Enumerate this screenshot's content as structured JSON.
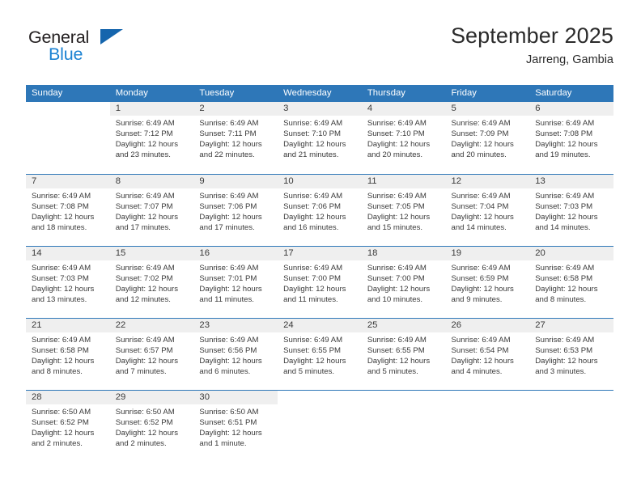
{
  "logo": {
    "word1": "General",
    "word2": "Blue",
    "triangle_color": "#1565ad",
    "word2_color": "#1b82d2"
  },
  "header": {
    "title": "September 2025",
    "subtitle": "Jarreng, Gambia"
  },
  "theme": {
    "header_blue": "#2e77b8",
    "daynum_gray": "#efefef",
    "text": "#3a3a3a"
  },
  "weekdays": [
    "Sunday",
    "Monday",
    "Tuesday",
    "Wednesday",
    "Thursday",
    "Friday",
    "Saturday"
  ],
  "labels": {
    "sunrise": "Sunrise:",
    "sunset": "Sunset:",
    "daylight": "Daylight:"
  },
  "weeks": [
    [
      {
        "day": "",
        "line1": "",
        "line2": "",
        "line3": "",
        "line4": "",
        "empty": true
      },
      {
        "day": "1",
        "line1": "Sunrise: 6:49 AM",
        "line2": "Sunset: 7:12 PM",
        "line3": "Daylight: 12 hours",
        "line4": "and 23 minutes."
      },
      {
        "day": "2",
        "line1": "Sunrise: 6:49 AM",
        "line2": "Sunset: 7:11 PM",
        "line3": "Daylight: 12 hours",
        "line4": "and 22 minutes."
      },
      {
        "day": "3",
        "line1": "Sunrise: 6:49 AM",
        "line2": "Sunset: 7:10 PM",
        "line3": "Daylight: 12 hours",
        "line4": "and 21 minutes."
      },
      {
        "day": "4",
        "line1": "Sunrise: 6:49 AM",
        "line2": "Sunset: 7:10 PM",
        "line3": "Daylight: 12 hours",
        "line4": "and 20 minutes."
      },
      {
        "day": "5",
        "line1": "Sunrise: 6:49 AM",
        "line2": "Sunset: 7:09 PM",
        "line3": "Daylight: 12 hours",
        "line4": "and 20 minutes."
      },
      {
        "day": "6",
        "line1": "Sunrise: 6:49 AM",
        "line2": "Sunset: 7:08 PM",
        "line3": "Daylight: 12 hours",
        "line4": "and 19 minutes."
      }
    ],
    [
      {
        "day": "7",
        "line1": "Sunrise: 6:49 AM",
        "line2": "Sunset: 7:08 PM",
        "line3": "Daylight: 12 hours",
        "line4": "and 18 minutes."
      },
      {
        "day": "8",
        "line1": "Sunrise: 6:49 AM",
        "line2": "Sunset: 7:07 PM",
        "line3": "Daylight: 12 hours",
        "line4": "and 17 minutes."
      },
      {
        "day": "9",
        "line1": "Sunrise: 6:49 AM",
        "line2": "Sunset: 7:06 PM",
        "line3": "Daylight: 12 hours",
        "line4": "and 17 minutes."
      },
      {
        "day": "10",
        "line1": "Sunrise: 6:49 AM",
        "line2": "Sunset: 7:06 PM",
        "line3": "Daylight: 12 hours",
        "line4": "and 16 minutes."
      },
      {
        "day": "11",
        "line1": "Sunrise: 6:49 AM",
        "line2": "Sunset: 7:05 PM",
        "line3": "Daylight: 12 hours",
        "line4": "and 15 minutes."
      },
      {
        "day": "12",
        "line1": "Sunrise: 6:49 AM",
        "line2": "Sunset: 7:04 PM",
        "line3": "Daylight: 12 hours",
        "line4": "and 14 minutes."
      },
      {
        "day": "13",
        "line1": "Sunrise: 6:49 AM",
        "line2": "Sunset: 7:03 PM",
        "line3": "Daylight: 12 hours",
        "line4": "and 14 minutes."
      }
    ],
    [
      {
        "day": "14",
        "line1": "Sunrise: 6:49 AM",
        "line2": "Sunset: 7:03 PM",
        "line3": "Daylight: 12 hours",
        "line4": "and 13 minutes."
      },
      {
        "day": "15",
        "line1": "Sunrise: 6:49 AM",
        "line2": "Sunset: 7:02 PM",
        "line3": "Daylight: 12 hours",
        "line4": "and 12 minutes."
      },
      {
        "day": "16",
        "line1": "Sunrise: 6:49 AM",
        "line2": "Sunset: 7:01 PM",
        "line3": "Daylight: 12 hours",
        "line4": "and 11 minutes."
      },
      {
        "day": "17",
        "line1": "Sunrise: 6:49 AM",
        "line2": "Sunset: 7:00 PM",
        "line3": "Daylight: 12 hours",
        "line4": "and 11 minutes."
      },
      {
        "day": "18",
        "line1": "Sunrise: 6:49 AM",
        "line2": "Sunset: 7:00 PM",
        "line3": "Daylight: 12 hours",
        "line4": "and 10 minutes."
      },
      {
        "day": "19",
        "line1": "Sunrise: 6:49 AM",
        "line2": "Sunset: 6:59 PM",
        "line3": "Daylight: 12 hours",
        "line4": "and 9 minutes."
      },
      {
        "day": "20",
        "line1": "Sunrise: 6:49 AM",
        "line2": "Sunset: 6:58 PM",
        "line3": "Daylight: 12 hours",
        "line4": "and 8 minutes."
      }
    ],
    [
      {
        "day": "21",
        "line1": "Sunrise: 6:49 AM",
        "line2": "Sunset: 6:58 PM",
        "line3": "Daylight: 12 hours",
        "line4": "and 8 minutes."
      },
      {
        "day": "22",
        "line1": "Sunrise: 6:49 AM",
        "line2": "Sunset: 6:57 PM",
        "line3": "Daylight: 12 hours",
        "line4": "and 7 minutes."
      },
      {
        "day": "23",
        "line1": "Sunrise: 6:49 AM",
        "line2": "Sunset: 6:56 PM",
        "line3": "Daylight: 12 hours",
        "line4": "and 6 minutes."
      },
      {
        "day": "24",
        "line1": "Sunrise: 6:49 AM",
        "line2": "Sunset: 6:55 PM",
        "line3": "Daylight: 12 hours",
        "line4": "and 5 minutes."
      },
      {
        "day": "25",
        "line1": "Sunrise: 6:49 AM",
        "line2": "Sunset: 6:55 PM",
        "line3": "Daylight: 12 hours",
        "line4": "and 5 minutes."
      },
      {
        "day": "26",
        "line1": "Sunrise: 6:49 AM",
        "line2": "Sunset: 6:54 PM",
        "line3": "Daylight: 12 hours",
        "line4": "and 4 minutes."
      },
      {
        "day": "27",
        "line1": "Sunrise: 6:49 AM",
        "line2": "Sunset: 6:53 PM",
        "line3": "Daylight: 12 hours",
        "line4": "and 3 minutes."
      }
    ],
    [
      {
        "day": "28",
        "line1": "Sunrise: 6:50 AM",
        "line2": "Sunset: 6:52 PM",
        "line3": "Daylight: 12 hours",
        "line4": "and 2 minutes."
      },
      {
        "day": "29",
        "line1": "Sunrise: 6:50 AM",
        "line2": "Sunset: 6:52 PM",
        "line3": "Daylight: 12 hours",
        "line4": "and 2 minutes."
      },
      {
        "day": "30",
        "line1": "Sunrise: 6:50 AM",
        "line2": "Sunset: 6:51 PM",
        "line3": "Daylight: 12 hours",
        "line4": "and 1 minute."
      },
      {
        "day": "",
        "line1": "",
        "line2": "",
        "line3": "",
        "line4": "",
        "empty": true
      },
      {
        "day": "",
        "line1": "",
        "line2": "",
        "line3": "",
        "line4": "",
        "empty": true
      },
      {
        "day": "",
        "line1": "",
        "line2": "",
        "line3": "",
        "line4": "",
        "empty": true
      },
      {
        "day": "",
        "line1": "",
        "line2": "",
        "line3": "",
        "line4": "",
        "empty": true
      }
    ]
  ]
}
